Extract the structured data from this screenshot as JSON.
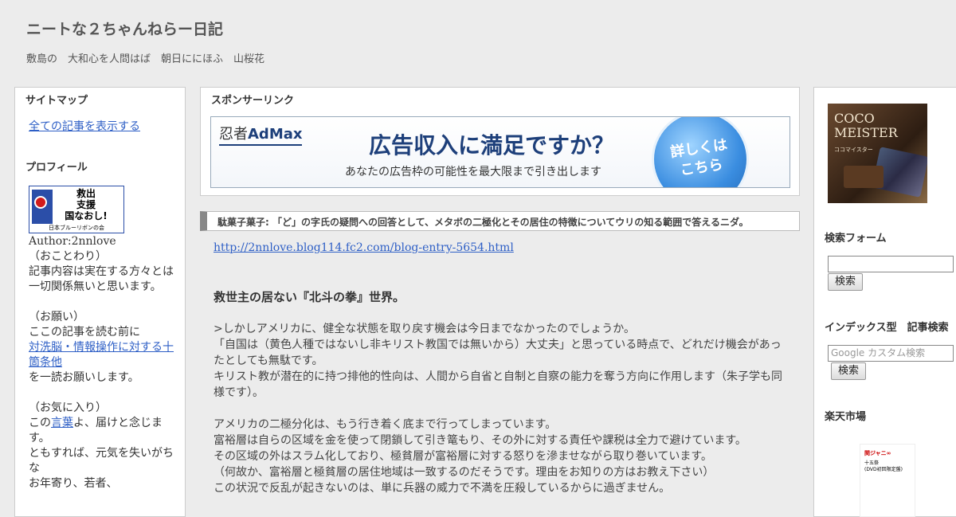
{
  "site": {
    "title": "ニートな２ちゃんねらー日記",
    "description": "敷島の　大和心を人問はば　朝日ににほふ　山桜花"
  },
  "left_sidebar": {
    "sitemap_heading": "サイトマップ",
    "all_articles_link": "全ての記事を表示する",
    "profile_heading": "プロフィール",
    "profile_image": {
      "banner_lines": [
        "救出",
        "支援",
        "国なおし!"
      ],
      "banner_sub": "日本ブルーリボンの会"
    },
    "author": "Author:2nnlove",
    "notice_heading": "（おことわり）",
    "notice_text": "記事内容は実在する方々とは一切関係無いと思います。",
    "request_heading": "（お願い）",
    "request_prefix": "ここの記事を読む前に",
    "request_link": "対洗脳・情報操作に対する十箇条他",
    "request_suffix": "を一読お願いします。",
    "favorite_heading": "（お気に入り）",
    "favorite_prefix": "この",
    "favorite_link": "言葉",
    "favorite_suffix": "よ、届けと念じます。",
    "favorite_text2": "ともすれば、元気を失いがちな",
    "favorite_text3": "お年寄り、若者、"
  },
  "sponsor": {
    "heading": "スポンサーリンク",
    "ad": {
      "logo_prefix": "忍者",
      "logo_main": "AdMax",
      "headline": "広告収入に満足ですか？",
      "sub": "あなたの広告枠の可能性を最大限まで引き出します",
      "circle_text_1": "詳しくは",
      "circle_text_2": "こちら"
    }
  },
  "post": {
    "title": "駄菓子菓子: 「ど」の字氏の疑問への回答として、メタボの二極化とその居住の特徴についてウリの知る範囲で答えるニダ。",
    "url": "http://2nnlove.blog114.fc2.com/blog-entry-5654.html",
    "heading": "救世主の居ない『北斗の拳』世界。",
    "paragraphs": [
      [
        ">しかしアメリカに、健全な状態を取り戻す機会は今日までなかったのでしょうか。",
        "「自国は（黄色人種ではないし非キリスト教国では無いから）大丈夫」と思っている時点で、どれだけ機会があったとしても無駄です。",
        "キリスト教が潜在的に持つ排他的性向は、人間から自省と自制と自察の能力を奪う方向に作用します（朱子学も同様です）。"
      ],
      [
        "アメリカの二極分化は、もう行き着く底まで行ってしまっています。",
        "富裕層は自らの区域を金を使って閉鎖して引き篭もり、その外に対する責任や課税は全力で避けています。",
        "その区域の外はスラム化しており、極貧層が富裕層に対する怒りを滲ませながら取り巻いています。",
        "（何故か、富裕層と極貧層の居住地域は一致するのだそうです。理由をお知りの方はお教え下さい）",
        "この状況で反乱が起きないのは、単に兵器の威力で不満を圧殺しているからに過ぎません。"
      ]
    ]
  },
  "right_sidebar": {
    "coco_image": {
      "logo_line1": "COCO",
      "logo_line2": "MEISTER",
      "logo_small": "ココマイスター"
    },
    "search_heading": "検索フォーム",
    "search_button": "検索",
    "index_heading": "インデックス型　記事検索",
    "google_placeholder": "Google カスタム検索",
    "google_button": "検索",
    "rakuten_heading": "楽天市場",
    "rakuten_image": {
      "title": "関ジャニ∞",
      "text_1": "十五祭",
      "text_2": "(DVD初回限定盤)"
    }
  }
}
